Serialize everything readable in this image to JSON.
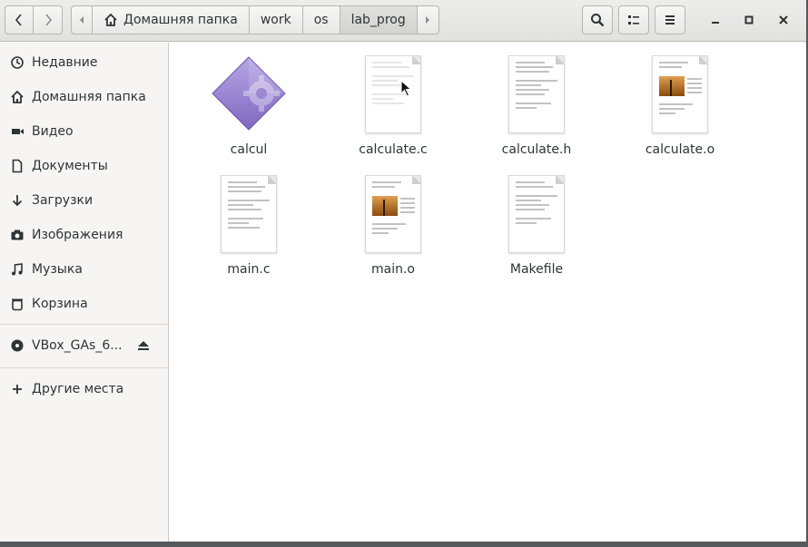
{
  "header": {
    "path": [
      "Домашняя папка",
      "work",
      "os",
      "lab_prog"
    ],
    "active_path_index": 3
  },
  "sidebar": {
    "places": [
      {
        "label": "Недавние",
        "icon": "clock-icon"
      },
      {
        "label": "Домашняя папка",
        "icon": "home-icon"
      },
      {
        "label": "Видео",
        "icon": "video-icon"
      },
      {
        "label": "Документы",
        "icon": "document-icon"
      },
      {
        "label": "Загрузки",
        "icon": "download-icon"
      },
      {
        "label": "Изображения",
        "icon": "camera-icon"
      },
      {
        "label": "Музыка",
        "icon": "music-icon"
      },
      {
        "label": "Корзина",
        "icon": "trash-icon"
      }
    ],
    "devices": [
      {
        "label": "VBox_GAs_6...",
        "icon": "disc-icon"
      }
    ],
    "other": {
      "label": "Другие места",
      "icon": "plus-icon"
    }
  },
  "files": [
    {
      "name": "calcul",
      "type": "executable",
      "icon": "executable-icon"
    },
    {
      "name": "calculate.c",
      "type": "text",
      "icon": "text-file-icon"
    },
    {
      "name": "calculate.h",
      "type": "text",
      "icon": "text-file-icon"
    },
    {
      "name": "calculate.o",
      "type": "object",
      "icon": "object-file-icon"
    },
    {
      "name": "main.c",
      "type": "text",
      "icon": "text-file-icon"
    },
    {
      "name": "main.o",
      "type": "object",
      "icon": "object-file-icon"
    },
    {
      "name": "Makefile",
      "type": "text",
      "icon": "text-file-icon"
    }
  ],
  "colors": {
    "headerbar": "#e8e8e6",
    "sidebar": "#f6f5f4",
    "executable_icon": "#9b87d4"
  }
}
